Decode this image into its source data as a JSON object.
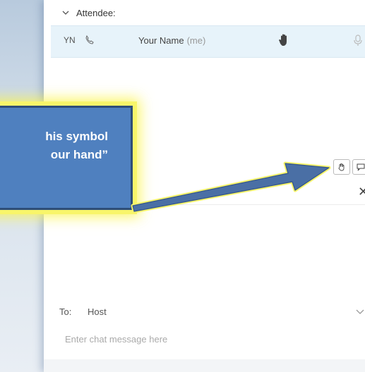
{
  "attendee_section": {
    "header": "Attendee:"
  },
  "attendee": {
    "initials": "YN",
    "name": "Your Name",
    "me_tag": "(me)"
  },
  "callout": {
    "text": "his symbol\nour hand”"
  },
  "chat": {
    "to_label": "To:",
    "to_value": "Host",
    "placeholder": "Enter chat message here"
  },
  "colors": {
    "callout_fill": "#4f80bf",
    "callout_glow": "#f8f56a",
    "arrow": "#4a6fa5",
    "row_highlight": "#e7f3fa"
  },
  "icons": [
    "chevron-down-icon",
    "phone-icon",
    "raise-hand-icon",
    "mic-icon",
    "close-icon",
    "chat-bubble-icon"
  ]
}
